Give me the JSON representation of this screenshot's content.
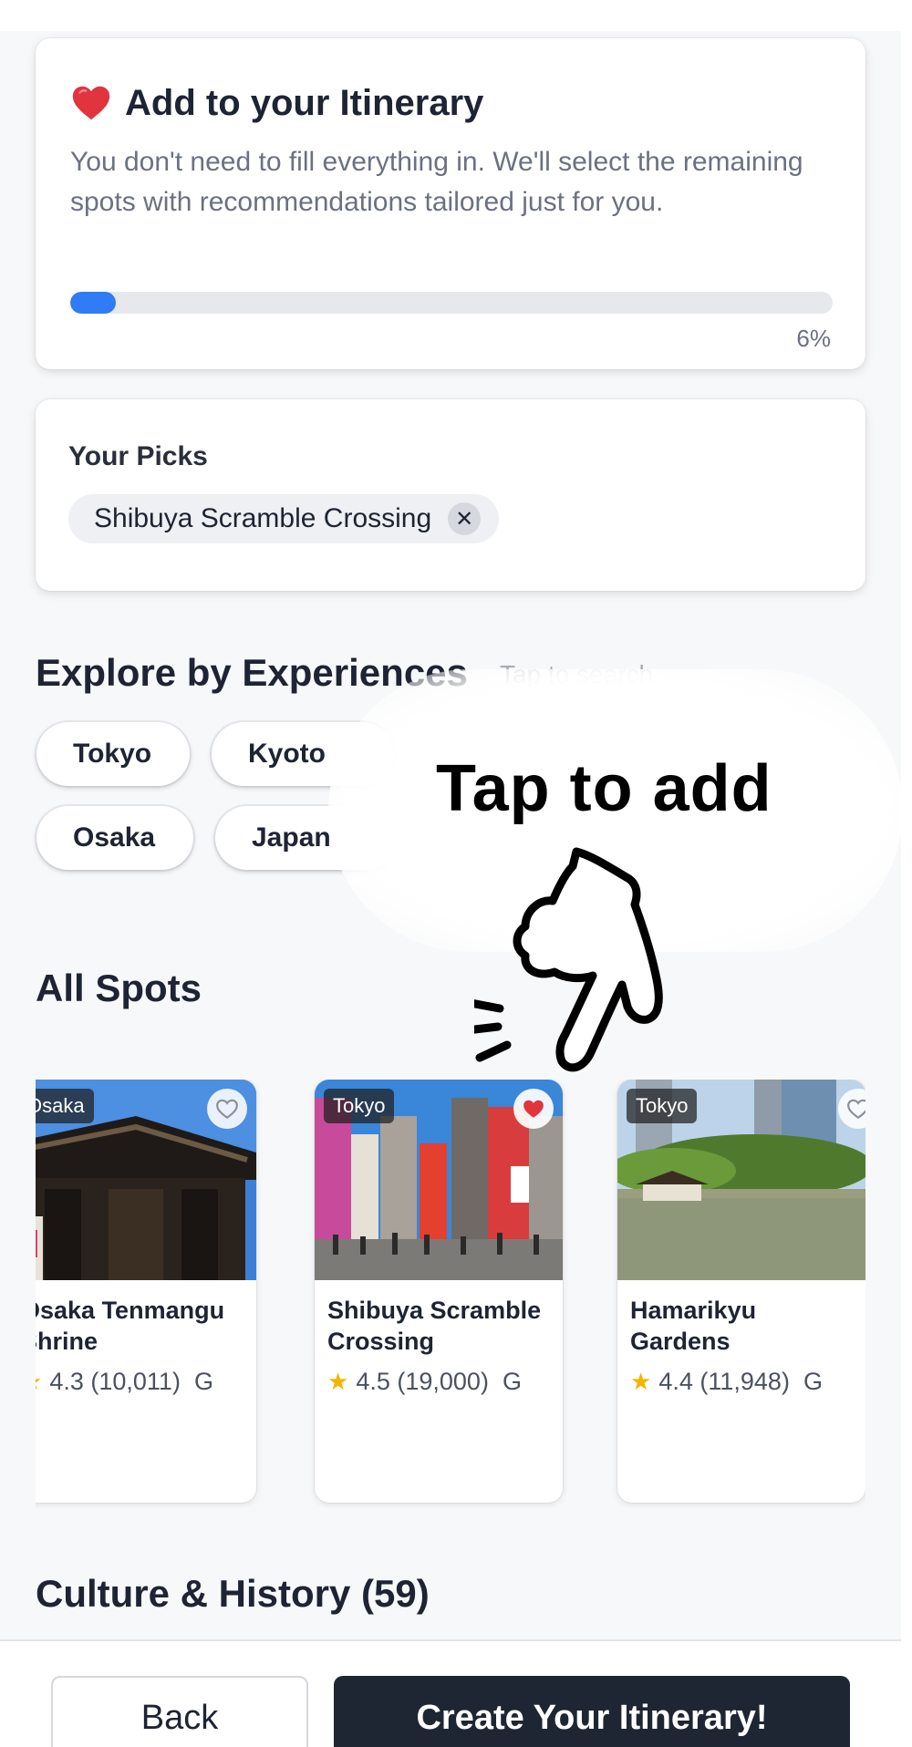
{
  "itinerary": {
    "title": "Add to your Itinerary",
    "description": "You don't need to fill everything in. We'll select the remaining spots with recommendations tailored just for you.",
    "progress_percent": 6,
    "progress_label": "6%"
  },
  "picks": {
    "title": "Your Picks",
    "items": [
      {
        "label": "Shibuya Scramble Crossing",
        "remove_icon": "close-icon"
      }
    ]
  },
  "experiences": {
    "title": "Explore by Experiences",
    "hint": "Tap to search",
    "chips": [
      {
        "label": "Tokyo"
      },
      {
        "label": "Kyoto"
      },
      {
        "label": "Osaka"
      },
      {
        "label": "Japan"
      }
    ]
  },
  "overlay": {
    "title": "Tap to add",
    "icon": "pointing-hand-icon"
  },
  "all_spots": {
    "title": "All Spots",
    "spots": [
      {
        "tag": "Osaka",
        "name": "Osaka Tenmangu Shrine",
        "rating": "4.3",
        "reviews": "(10,011)",
        "source": "G",
        "favorited": false
      },
      {
        "tag": "Tokyo",
        "name": "Shibuya Scramble Crossing",
        "rating": "4.5",
        "reviews": "(19,000)",
        "source": "G",
        "favorited": true
      },
      {
        "tag": "Tokyo",
        "name": "Hamarikyu Gardens",
        "rating": "4.4",
        "reviews": "(11,948)",
        "source": "G",
        "favorited": false
      }
    ]
  },
  "next_section": {
    "title": "Culture & History (59)"
  },
  "footer": {
    "back_label": "Back",
    "create_label": "Create Your Itinerary!"
  },
  "colors": {
    "accent": "#2f7cf6",
    "primary_button": "#1f2633",
    "heart": "#e0343f",
    "star": "#f4b400"
  }
}
